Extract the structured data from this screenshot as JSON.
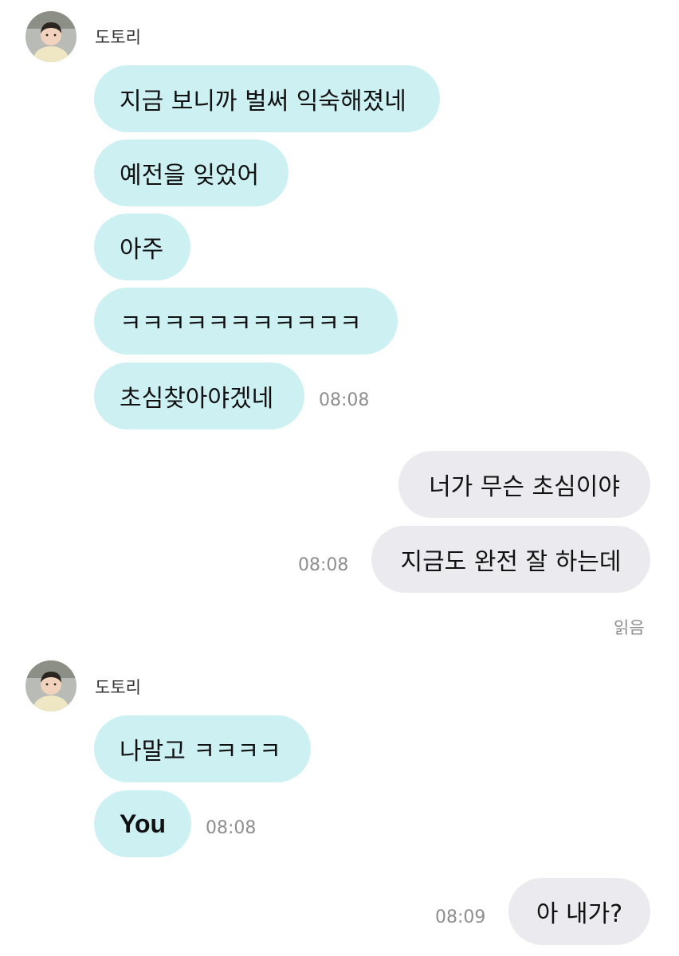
{
  "blocks": [
    {
      "sender_name": "도토리",
      "messages": [
        "지금 보니까 벌써 익숙해졌네",
        "예전을 잊었어",
        "아주",
        "ㅋㅋㅋㅋㅋㅋㅋㅋㅋㅋㅋ",
        "초심찾아야겠네"
      ],
      "time": "08:08"
    },
    {
      "messages": [
        "너가 무슨 초심이야",
        "지금도 완전 잘 하는데"
      ],
      "time": "08:08",
      "read_label": "읽음"
    },
    {
      "sender_name": "도토리",
      "messages": [
        "나말고 ㅋㅋㅋㅋ",
        "You"
      ],
      "time": "08:08"
    },
    {
      "messages": [
        "아 내가?"
      ],
      "time": "08:09"
    }
  ],
  "colors": {
    "incoming_bubble": "#cdf1f3",
    "outgoing_bubble": "#ebebef",
    "timestamp": "#8e8e8e"
  },
  "icons": {
    "avatar": "profile-photo-child"
  }
}
